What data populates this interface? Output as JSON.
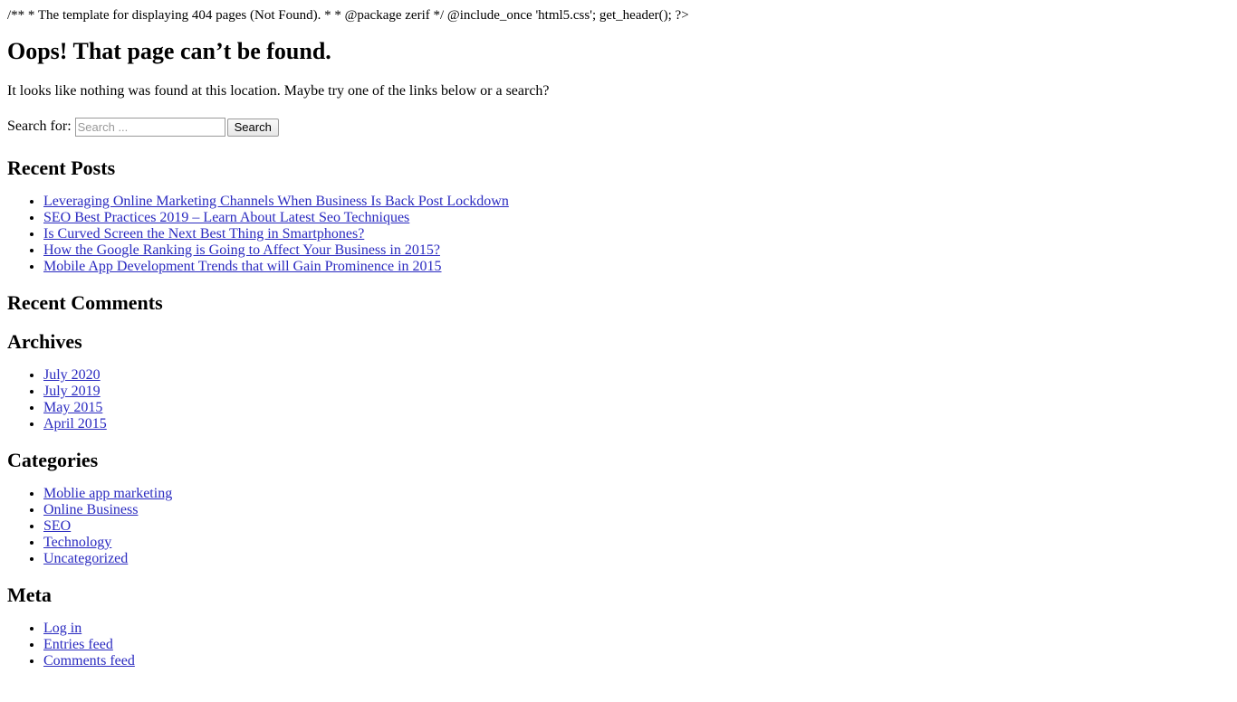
{
  "raw_php_comment": "/** * The template for displaying 404 pages (Not Found). * * @package zerif */ @include_once 'html5.css'; get_header(); ?>",
  "page": {
    "title": "Oops! That page can’t be found.",
    "intro": "It looks like nothing was found at this location. Maybe try one of the links below or a search?"
  },
  "search": {
    "label": "Search for:",
    "placeholder": "Search ...",
    "value": "",
    "submit_label": "Search"
  },
  "widgets": [
    {
      "id": "recent-posts",
      "title": "Recent Posts",
      "items": [
        "Leveraging Online Marketing Channels When Business Is Back Post Lockdown",
        "SEO Best Practices 2019 – Learn About Latest Seo Techniques",
        "Is Curved Screen the Next Best Thing in Smartphones?",
        "How the Google Ranking is Going to Affect Your Business in 2015?",
        "Mobile App Development Trends that will Gain Prominence in 2015"
      ]
    },
    {
      "id": "recent-comments",
      "title": "Recent Comments",
      "items": []
    },
    {
      "id": "archives",
      "title": "Archives",
      "items": [
        "July 2020",
        "July 2019",
        "May 2015",
        "April 2015"
      ]
    },
    {
      "id": "categories",
      "title": "Categories",
      "items": [
        "Moblie app marketing",
        "Online Business",
        "SEO",
        "Technology",
        "Uncategorized"
      ]
    },
    {
      "id": "meta",
      "title": "Meta",
      "items": [
        "Log in",
        "Entries feed",
        "Comments feed"
      ]
    }
  ],
  "colors": {
    "link": "#2a2ac0",
    "text": "#000000",
    "background": "#ffffff",
    "placeholder": "#999999",
    "input_border": "#9a9a9a",
    "button_face": "#efefef"
  }
}
